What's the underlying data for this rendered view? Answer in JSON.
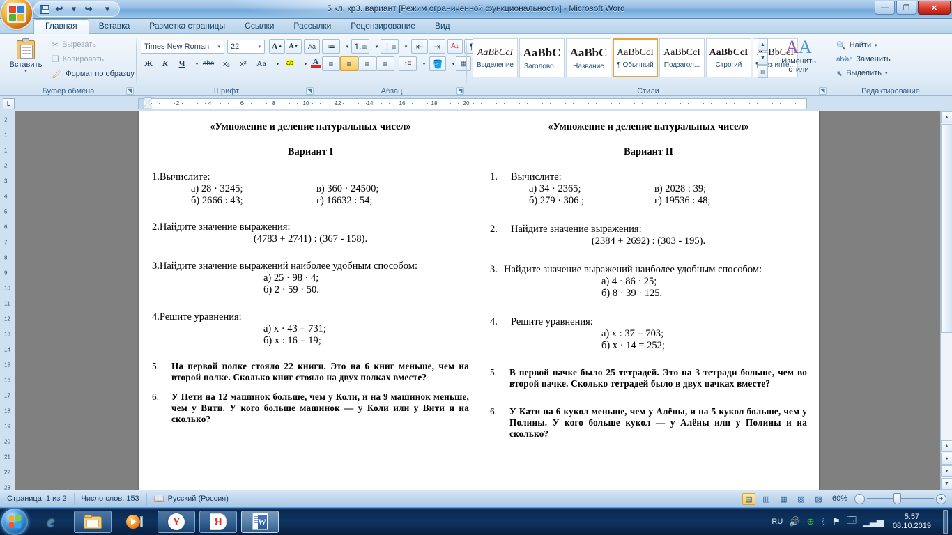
{
  "window": {
    "title": "5 кл. кр3. вариант [Режим ограниченной функциональности] - Microsoft Word",
    "minimize": "—",
    "maximize": "❐",
    "close": "✕"
  },
  "qat": {
    "save": "save-icon",
    "undo": "↩",
    "redo": "↪",
    "customize": "▾"
  },
  "tabs": [
    {
      "label": "Главная",
      "active": true
    },
    {
      "label": "Вставка",
      "active": false
    },
    {
      "label": "Разметка страницы",
      "active": false
    },
    {
      "label": "Ссылки",
      "active": false
    },
    {
      "label": "Рассылки",
      "active": false
    },
    {
      "label": "Рецензирование",
      "active": false
    },
    {
      "label": "Вид",
      "active": false
    }
  ],
  "ribbon": {
    "clipboard": {
      "group_label": "Буфер обмена",
      "paste_label": "Вставить",
      "cut_label": "Вырезать",
      "copy_label": "Копировать",
      "format_painter_label": "Формат по образцу"
    },
    "font": {
      "group_label": "Шрифт",
      "font_name": "Times New Roman",
      "font_size": "22",
      "grow_font": "A",
      "shrink_font": "A",
      "clear_format": "Aa",
      "bold": "Ж",
      "italic": "К",
      "underline": "Ч",
      "strikethrough": "abc",
      "subscript": "x₂",
      "superscript": "x²",
      "change_case": "Aa",
      "highlight": "ab",
      "font_color": "A"
    },
    "paragraph": {
      "group_label": "Абзац",
      "bullets": "bullets-icon",
      "numbering": "numbering-icon",
      "multilevel": "multilevel-list-icon",
      "decrease_indent": "decrease-indent-icon",
      "increase_indent": "increase-indent-icon",
      "sort": "sort-icon",
      "show_marks": "¶",
      "align_left": "align-left-icon",
      "align_center": "align-center-icon",
      "align_right": "align-right-icon",
      "justify": "justify-icon",
      "line_spacing": "line-spacing-icon",
      "shading": "shading-icon",
      "borders": "borders-icon"
    },
    "styles": {
      "group_label": "Стили",
      "change_styles_label": "Изменить стили",
      "items": [
        {
          "preview": "AaBbCcI",
          "name": "Выделение",
          "selected": false,
          "style": "italic-serif"
        },
        {
          "preview": "AaBbC",
          "name": "Заголово...",
          "selected": false,
          "style": "bold-large"
        },
        {
          "preview": "AaBbC",
          "name": "Название",
          "selected": false,
          "style": "bold-large"
        },
        {
          "preview": "AaBbCcI",
          "name": "¶ Обычный",
          "selected": true,
          "style": "normal"
        },
        {
          "preview": "AaBbCcI",
          "name": "Подзагол...",
          "selected": false,
          "style": "normal"
        },
        {
          "preview": "AaBbCcI",
          "name": "Строгий",
          "selected": false,
          "style": "bold"
        },
        {
          "preview": "AaBbCcI",
          "name": "¶ Без инте...",
          "selected": false,
          "style": "normal"
        }
      ]
    },
    "editing": {
      "group_label": "Редактирование",
      "find_label": "Найти",
      "replace_label": "Заменить",
      "select_label": "Выделить"
    }
  },
  "ruler": {
    "tab_selector": "L",
    "numbers": [
      "2",
      "4",
      "6",
      "8",
      "10",
      "12",
      "14",
      "16",
      "18",
      "20"
    ],
    "vertical_numbers": [
      "2",
      "1",
      "1",
      "2",
      "3",
      "4",
      "5",
      "6",
      "7",
      "8",
      "9",
      "10",
      "11",
      "12",
      "13",
      "14",
      "15",
      "16",
      "17",
      "18",
      "19",
      "20",
      "21",
      "22",
      "23"
    ]
  },
  "document": {
    "columns": [
      {
        "title": "«Умножение и деление натуральных чисел»",
        "variant": "Вариант I",
        "tasks": [
          {
            "num": "1.",
            "text": "Вычислите:",
            "rows": [
              {
                "a": "а) 28 · 3245;",
                "b": "в) 360 · 24500;"
              },
              {
                "a": "б) 2666 : 43;",
                "b": "г) 16632 : 54;"
              }
            ]
          },
          {
            "num": "2.",
            "text": "Найдите значение выражения:",
            "center": "(4783 + 2741) : (367 - 158)."
          },
          {
            "num": "3.",
            "text": "Найдите   значение   выражений   наиболее   удобным способом:",
            "lines": [
              "а) 25 · 98 · 4;",
              "б) 2 · 59 · 50."
            ]
          },
          {
            "num": "4.",
            "text": "Решите уравнения:",
            "lines": [
              "а) x · 43 = 731;",
              "б) x : 16 = 19;"
            ]
          }
        ],
        "word_problems": [
          {
            "num": "5.",
            "text": "На первой полке стояло 22 книги. Это на 6 книг меньше, чем на второй полке. Сколько книг стояло на двух пол­ках вместе?"
          },
          {
            "num": "6.",
            "text": "У Пети на 12 машинок больше, чем у Коли, и на 9 ма­шинок меньше, чем у Вити. У кого больше машинок — у Коли или у Вити и на сколько?"
          }
        ]
      },
      {
        "title": "«Умножение и деление натуральных чисел»",
        "variant": "Вариант II",
        "tasks": [
          {
            "num": "1.",
            "text": "Вычислите:",
            "rows": [
              {
                "a": "а) 34 · 2365;",
                "b": "в) 2028 : 39;"
              },
              {
                "a": "б) 279 · 306 ;",
                "b": "г) 19536 : 48;"
              }
            ]
          },
          {
            "num": "2.",
            "text": "Найдите значение выражения:",
            "center": "(2384 + 2692) : (303 - 195)."
          },
          {
            "num": "3.",
            "text": "Найдите   значение   выражений   наиболее   удобным способом:",
            "lines": [
              "а) 4 · 86 · 25;",
              "б) 8 · 39 · 125."
            ]
          },
          {
            "num": "4.",
            "text": "Решите уравнения:",
            "lines": [
              "а) x : 37 = 703;",
              "б) x · 14 = 252;"
            ]
          }
        ],
        "word_problems": [
          {
            "num": "5.",
            "text": "В первой пачке было 25 тетрадей. Это на 3 тетради боль­ше, чем во второй пачке. Сколько тетрадей было в двух пачках вместе?"
          },
          {
            "num": "6.",
            "text": "У Кати на 6 кукол меньше, чем у Алёны, и на 5 кукол больше, чем у Полины. У кого больше кукол — у Алёны или у Полины и на сколько?"
          }
        ]
      }
    ]
  },
  "statusbar": {
    "page": "Страница: 1 из 2",
    "words": "Число слов: 153",
    "language": "Русский (Россия)",
    "zoom": "60%",
    "zoom_out": "–",
    "zoom_in": "+",
    "views": [
      {
        "name": "print-layout-view",
        "glyph": "▤",
        "active": true
      },
      {
        "name": "full-screen-reading-view",
        "glyph": "▥",
        "active": false
      },
      {
        "name": "web-layout-view",
        "glyph": "▦",
        "active": false
      },
      {
        "name": "outline-view",
        "glyph": "▧",
        "active": false
      },
      {
        "name": "draft-view",
        "glyph": "▨",
        "active": false
      }
    ]
  },
  "taskbar": {
    "start": "start-orb",
    "items": [
      {
        "name": "internet-explorer",
        "label": "e"
      },
      {
        "name": "file-explorer",
        "label": ""
      },
      {
        "name": "windows-media-player",
        "label": ""
      },
      {
        "name": "yandex-browser",
        "label": "Y"
      },
      {
        "name": "yandex",
        "label": "Я"
      },
      {
        "name": "microsoft-word",
        "label": "W"
      }
    ],
    "tray": {
      "language": "RU",
      "volume": "volume-icon",
      "update": "update-icon",
      "bluetooth": "bluetooth-icon",
      "network": "network-flag-icon",
      "action_center": "action-center-icon",
      "signal": "signal-icon",
      "time": "5:57",
      "date": "08.10.2019"
    }
  }
}
